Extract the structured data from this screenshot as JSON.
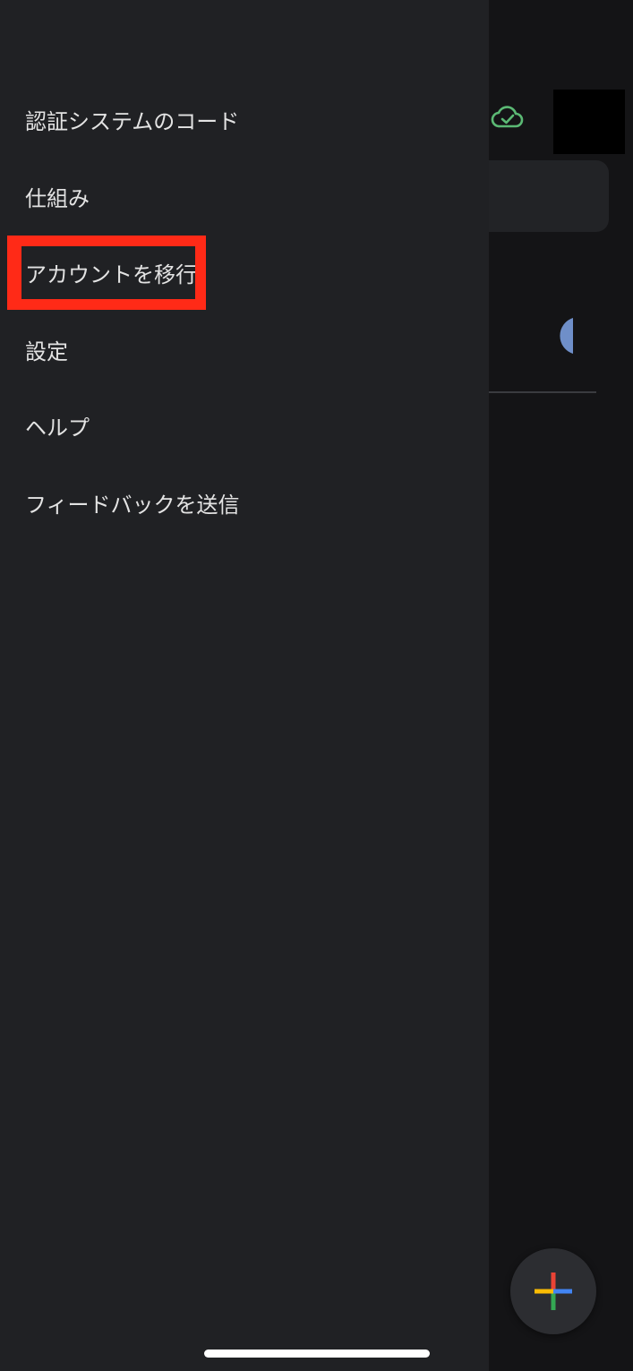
{
  "drawer": {
    "items": [
      {
        "label": "認証システムのコード"
      },
      {
        "label": "仕組み"
      },
      {
        "label": "アカウントを移行"
      },
      {
        "label": "設定"
      },
      {
        "label": "ヘルプ"
      },
      {
        "label": "フィードバックを送信"
      }
    ],
    "highlighted_item": "アカウントを移行"
  },
  "background_app": {
    "icons": [
      "cloud-sync-check-icon",
      "timer-icon",
      "add-icon"
    ]
  },
  "colors": {
    "drawer_bg": "#202124",
    "screen_bg": "#141416",
    "text": "#e3e3e3",
    "highlight": "#ff2a17",
    "sync_green": "#5bb974",
    "timer_blue": "#6f8fc9"
  }
}
